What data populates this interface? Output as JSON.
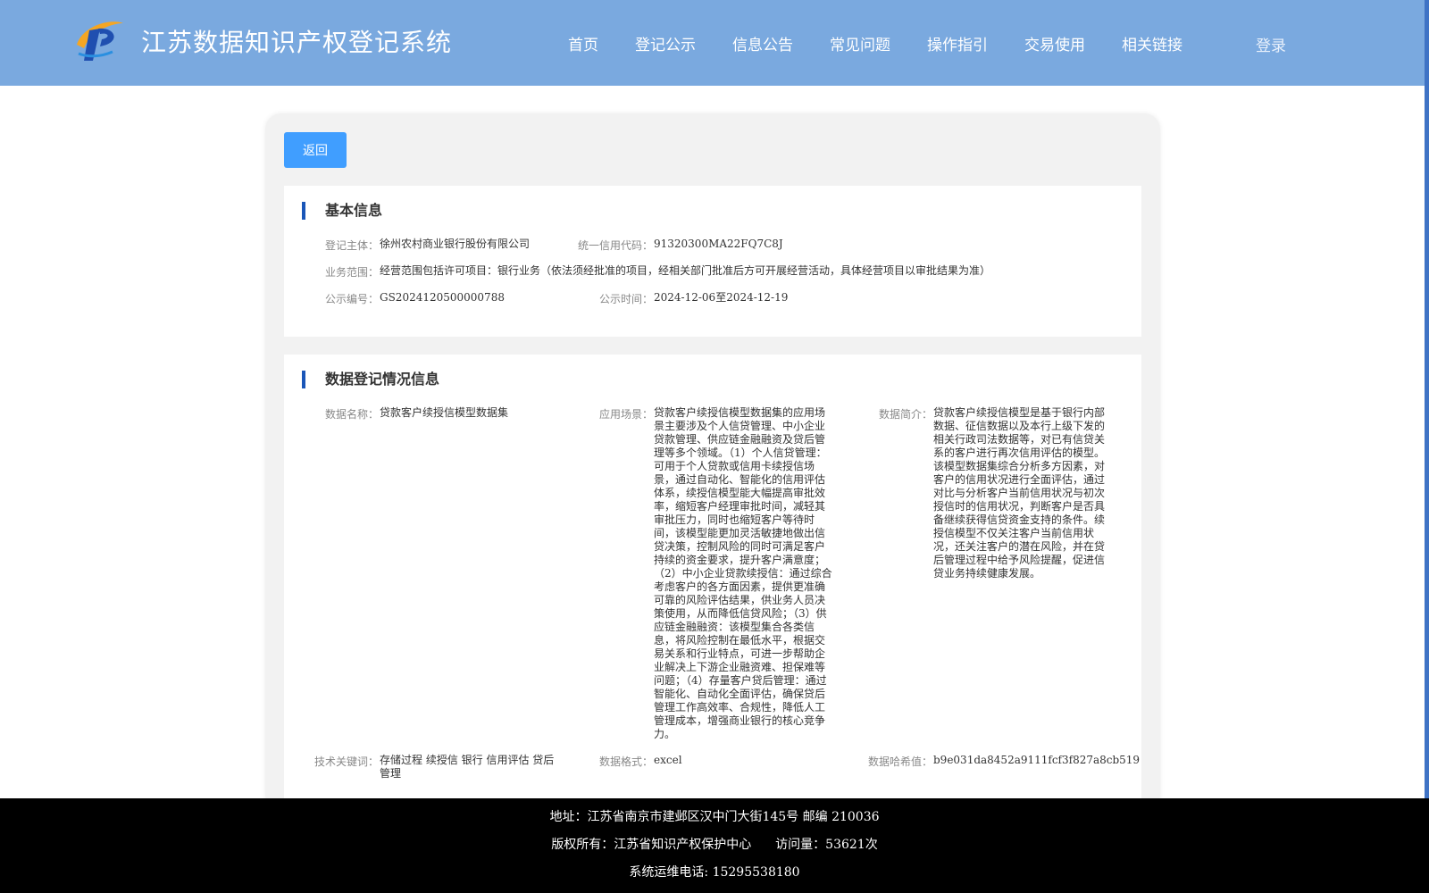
{
  "header": {
    "title": "江苏数据知识产权登记系统",
    "nav": [
      "首页",
      "登记公示",
      "信息公告",
      "常见问题",
      "操作指引",
      "交易使用",
      "相关链接"
    ],
    "login": "登录",
    "logo_icon": "ip-logo-icon"
  },
  "actions": {
    "back": "返回"
  },
  "basic": {
    "title": "基本信息",
    "subject_label": "登记主体：",
    "subject": "徐州农村商业银行股份有限公司",
    "credit_label": "统一信用代码：",
    "credit": "91320300MA22FQ7C8J",
    "scope_label": "业务范围：",
    "scope": "经营范围包括许可项目：银行业务（依法须经批准的项目，经相关部门批准后方可开展经营活动，具体经营项目以审批结果为准）",
    "pub_no_label": "公示编号：",
    "pub_no": "GS2024120500000788",
    "pub_time_label": "公示时间：",
    "pub_time": "2024-12-06至2024-12-19"
  },
  "registration": {
    "title": "数据登记情况信息",
    "name_label": "数据名称：",
    "name": "贷款客户续授信模型数据集",
    "scene_label": "应用场景：",
    "scene": "贷款客户续授信模型数据集的应用场景主要涉及个人信贷管理、中小企业贷款管理、供应链金融融资及贷后管理等多个领域。（1）个人信贷管理：可用于个人贷款或信用卡续授信场景，通过自动化、智能化的信用评估体系，续授信模型能大幅提高审批效率，缩短客户经理审批时间，减轻其审批压力，同时也缩短客户等待时间，该模型能更加灵活敏捷地做出信贷决策，控制风险的同时可满足客户持续的资金要求，提升客户满意度；（2）中小企业贷款续授信：通过综合考虑客户的各方面因素，提供更准确可靠的风险评估结果，供业务人员决策使用，从而降低信贷风险；（3）供应链金融融资：该模型集合各类信息，将风险控制在最低水平，根据交易关系和行业特点，可进一步帮助企业解决上下游企业融资难、担保难等问题；（4）存量客户贷后管理：通过智能化、自动化全面评估，确保贷后管理工作高效率、合规性，降低人工管理成本，增强商业银行的核心竞争力。",
    "intro_label": "数据简介：",
    "intro": "贷款客户续授信模型是基于银行内部数据、征信数据以及本行上级下发的相关行政司法数据等，对已有信贷关系的客户进行再次信用评估的模型。该模型数据集综合分析多方因素，对客户的信用状况进行全面评估，通过对比与分析客户当前信用状况与初次授信时的信用状况，判断客户是否具备继续获得信贷资金支持的条件。续授信模型不仅关注客户当前信用状况，还关注客户的潜在风险，并在贷后管理过程中给予风险提醒，促进信贷业务持续健康发展。",
    "keywords_label": "技术关键词：",
    "keywords": "存储过程 续授信 银行 信用评估 贷后管理",
    "format_label": "数据格式：",
    "format": "excel",
    "hash_label": "数据哈希值：",
    "hash": "b9e031da8452a9111fcf3f827a8cb519"
  },
  "footer": {
    "address": "地址：江苏省南京市建邺区汉中门大街145号 邮编 210036",
    "copyright": "版权所有：江苏省知识产权保护中心",
    "visits": "访问量：53621次",
    "phone": "系统运维电话: 15295538180"
  }
}
